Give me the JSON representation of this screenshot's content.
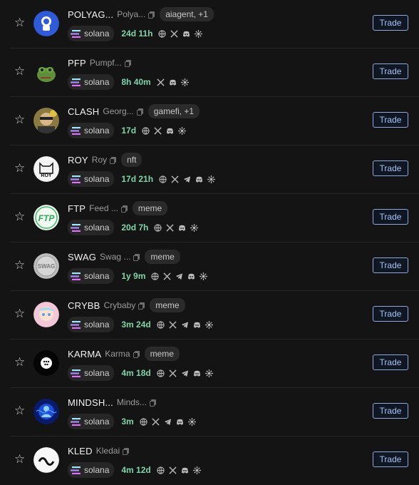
{
  "chain_label": "solana",
  "trade_label": "Trade",
  "colors": {
    "background": "#141414",
    "age": "#7fd4a8",
    "trade_border": "#8fa8d8"
  },
  "rows": [
    {
      "ticker": "POLYAG...",
      "name": "Polya...",
      "tag": "aiagent, +1",
      "age": "24d 11h",
      "socials": [
        "globe-icon",
        "x-icon",
        "discord-icon",
        "pump-icon"
      ]
    },
    {
      "ticker": "PFP",
      "name": "Pumpf...",
      "tag": "",
      "age": "8h 40m",
      "socials": [
        "x-icon",
        "discord-icon",
        "pump-icon"
      ]
    },
    {
      "ticker": "CLASH",
      "name": "Georg...",
      "tag": "gamefi, +1",
      "age": "17d",
      "socials": [
        "globe-icon",
        "x-icon",
        "discord-icon",
        "pump-icon"
      ]
    },
    {
      "ticker": "ROY",
      "name": "Roy",
      "tag": "nft",
      "age": "17d 21h",
      "socials": [
        "globe-icon",
        "x-icon",
        "telegram-icon",
        "discord-icon",
        "pump-icon"
      ]
    },
    {
      "ticker": "FTP",
      "name": "Feed ...",
      "tag": "meme",
      "age": "20d 7h",
      "socials": [
        "globe-icon",
        "x-icon",
        "discord-icon",
        "pump-icon"
      ]
    },
    {
      "ticker": "SWAG",
      "name": "Swag ...",
      "tag": "meme",
      "age": "1y 9m",
      "socials": [
        "globe-icon",
        "x-icon",
        "telegram-icon",
        "discord-icon",
        "pump-icon"
      ]
    },
    {
      "ticker": "CRYBB",
      "name": "Crybaby",
      "tag": "meme",
      "age": "3m 24d",
      "socials": [
        "globe-icon",
        "x-icon",
        "telegram-icon",
        "discord-icon",
        "pump-icon"
      ]
    },
    {
      "ticker": "KARMA",
      "name": "Karma",
      "tag": "meme",
      "age": "4m 18d",
      "socials": [
        "globe-icon",
        "x-icon",
        "telegram-icon",
        "discord-icon",
        "pump-icon"
      ]
    },
    {
      "ticker": "MINDSH...",
      "name": "Minds...",
      "tag": "",
      "age": "3m",
      "socials": [
        "globe-icon",
        "x-icon",
        "telegram-icon",
        "discord-icon",
        "pump-icon"
      ]
    },
    {
      "ticker": "KLED",
      "name": "Kledai",
      "tag": "",
      "age": "4m 12d",
      "socials": [
        "globe-icon",
        "x-icon",
        "discord-icon",
        "pump-icon"
      ]
    }
  ]
}
